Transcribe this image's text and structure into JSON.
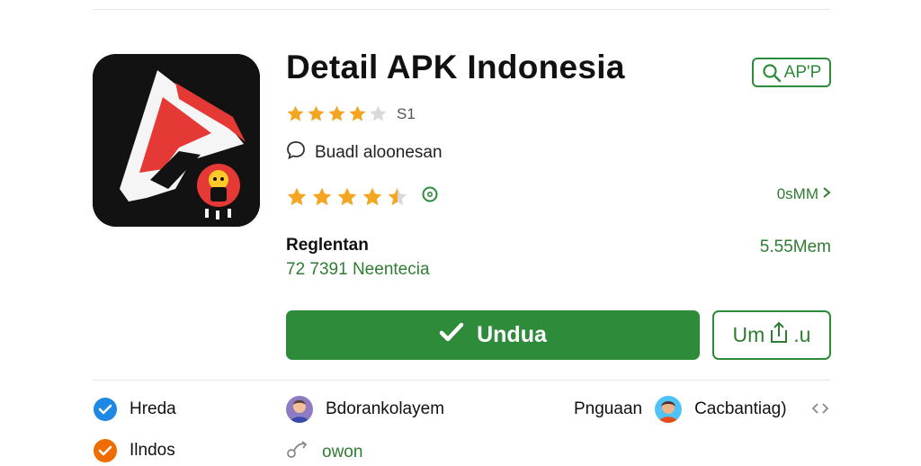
{
  "app": {
    "title": "Detail APK Indonesia",
    "badge_label": "AP'P",
    "rating_count": "S1",
    "developer": "Buadl aloonesan",
    "size_link": "0sMM",
    "release_label": "Reglentan",
    "downloads_text": "72 7391 Neentecia",
    "size_value": "5.55Mem"
  },
  "ratings": {
    "top_stars": 4,
    "bottom_stars": 4.5,
    "max": 5
  },
  "actions": {
    "download_label": "Undua",
    "secondary_left": "Um",
    "secondary_right": ".u"
  },
  "info": {
    "item1": "Hreda",
    "item2": "Bdorankolayem",
    "item3_label": "Pnguaan",
    "item3_value": "Cacbantiag)",
    "item4": "Ilndos",
    "item5": "owon"
  },
  "colors": {
    "accent_green": "#2e8b3a",
    "star_orange": "#f4a623",
    "check_blue": "#1e88e5",
    "check_orange": "#ef6c00"
  },
  "icons": {
    "badge": "search-icon",
    "developer": "chat-bubble-icon",
    "download": "check-icon",
    "secondary": "share-icon",
    "more": "chevron-right-icon",
    "item1": "verified-check-icon",
    "item4": "check-circle-icon",
    "item5": "share-link-icon",
    "trailing": "code-icon"
  }
}
